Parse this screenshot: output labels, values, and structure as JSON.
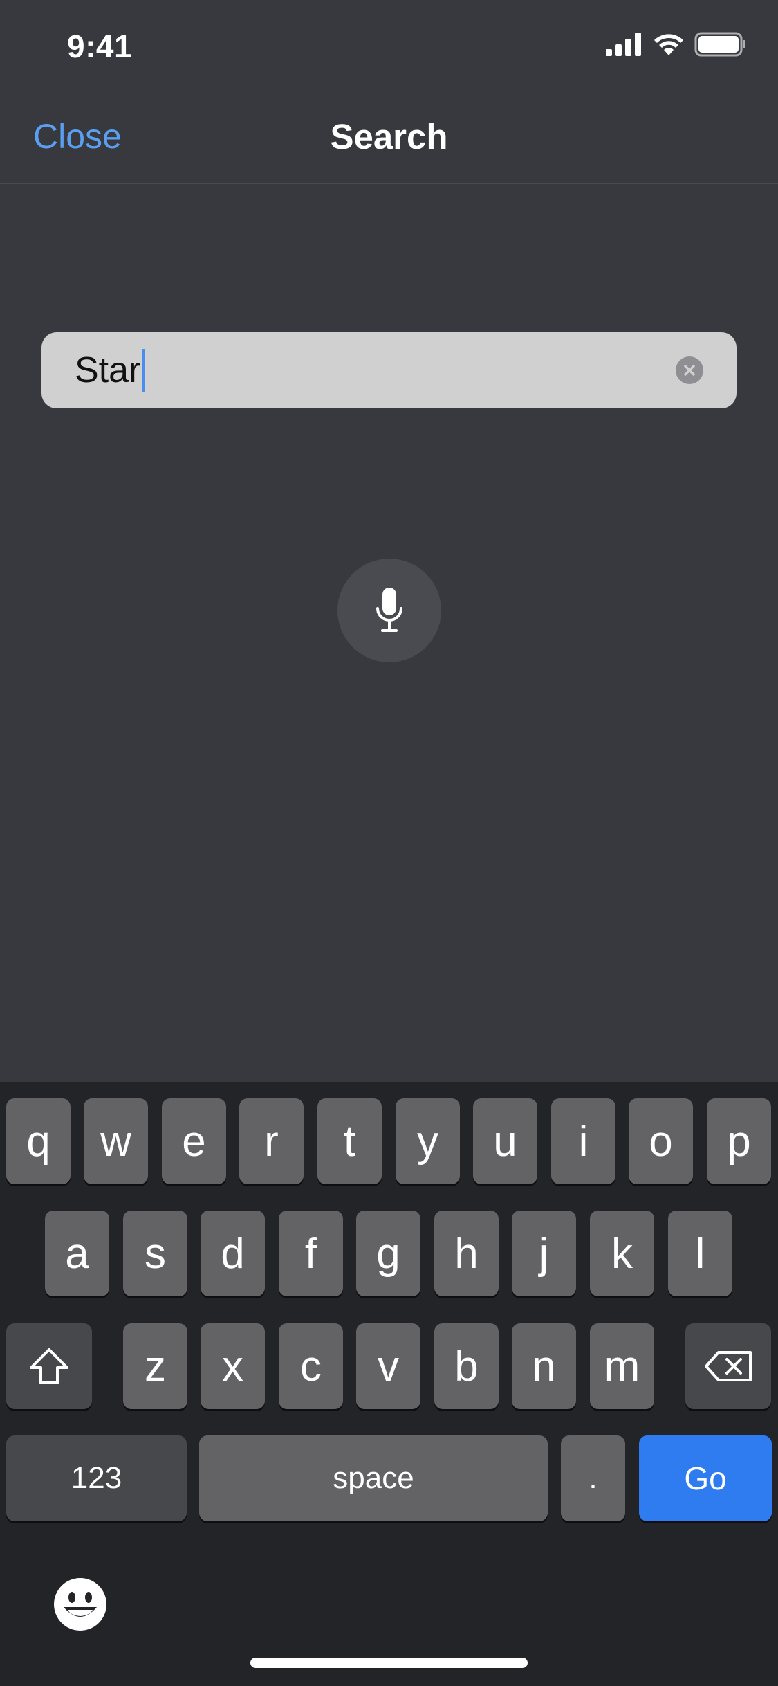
{
  "status_bar": {
    "time": "9:41"
  },
  "nav": {
    "close_label": "Close",
    "title": "Search"
  },
  "search": {
    "value": "Star"
  },
  "keyboard": {
    "row1": [
      "q",
      "w",
      "e",
      "r",
      "t",
      "y",
      "u",
      "i",
      "o",
      "p"
    ],
    "row2": [
      "a",
      "s",
      "d",
      "f",
      "g",
      "h",
      "j",
      "k",
      "l"
    ],
    "row3": [
      "z",
      "x",
      "c",
      "v",
      "b",
      "n",
      "m"
    ],
    "numbers_label": "123",
    "space_label": "space",
    "period_label": ".",
    "go_label": "Go"
  },
  "colors": {
    "background": "#38393e",
    "accent": "#5b9ff0",
    "go_button": "#2f7cf0",
    "keyboard_bg": "#232427",
    "key": "#636366"
  },
  "icons": {
    "signal": "signal-icon",
    "wifi": "wifi-icon",
    "battery": "battery-icon",
    "clear": "clear-icon",
    "microphone": "microphone-icon",
    "shift": "shift-icon",
    "delete": "delete-icon",
    "emoji": "emoji-icon"
  }
}
